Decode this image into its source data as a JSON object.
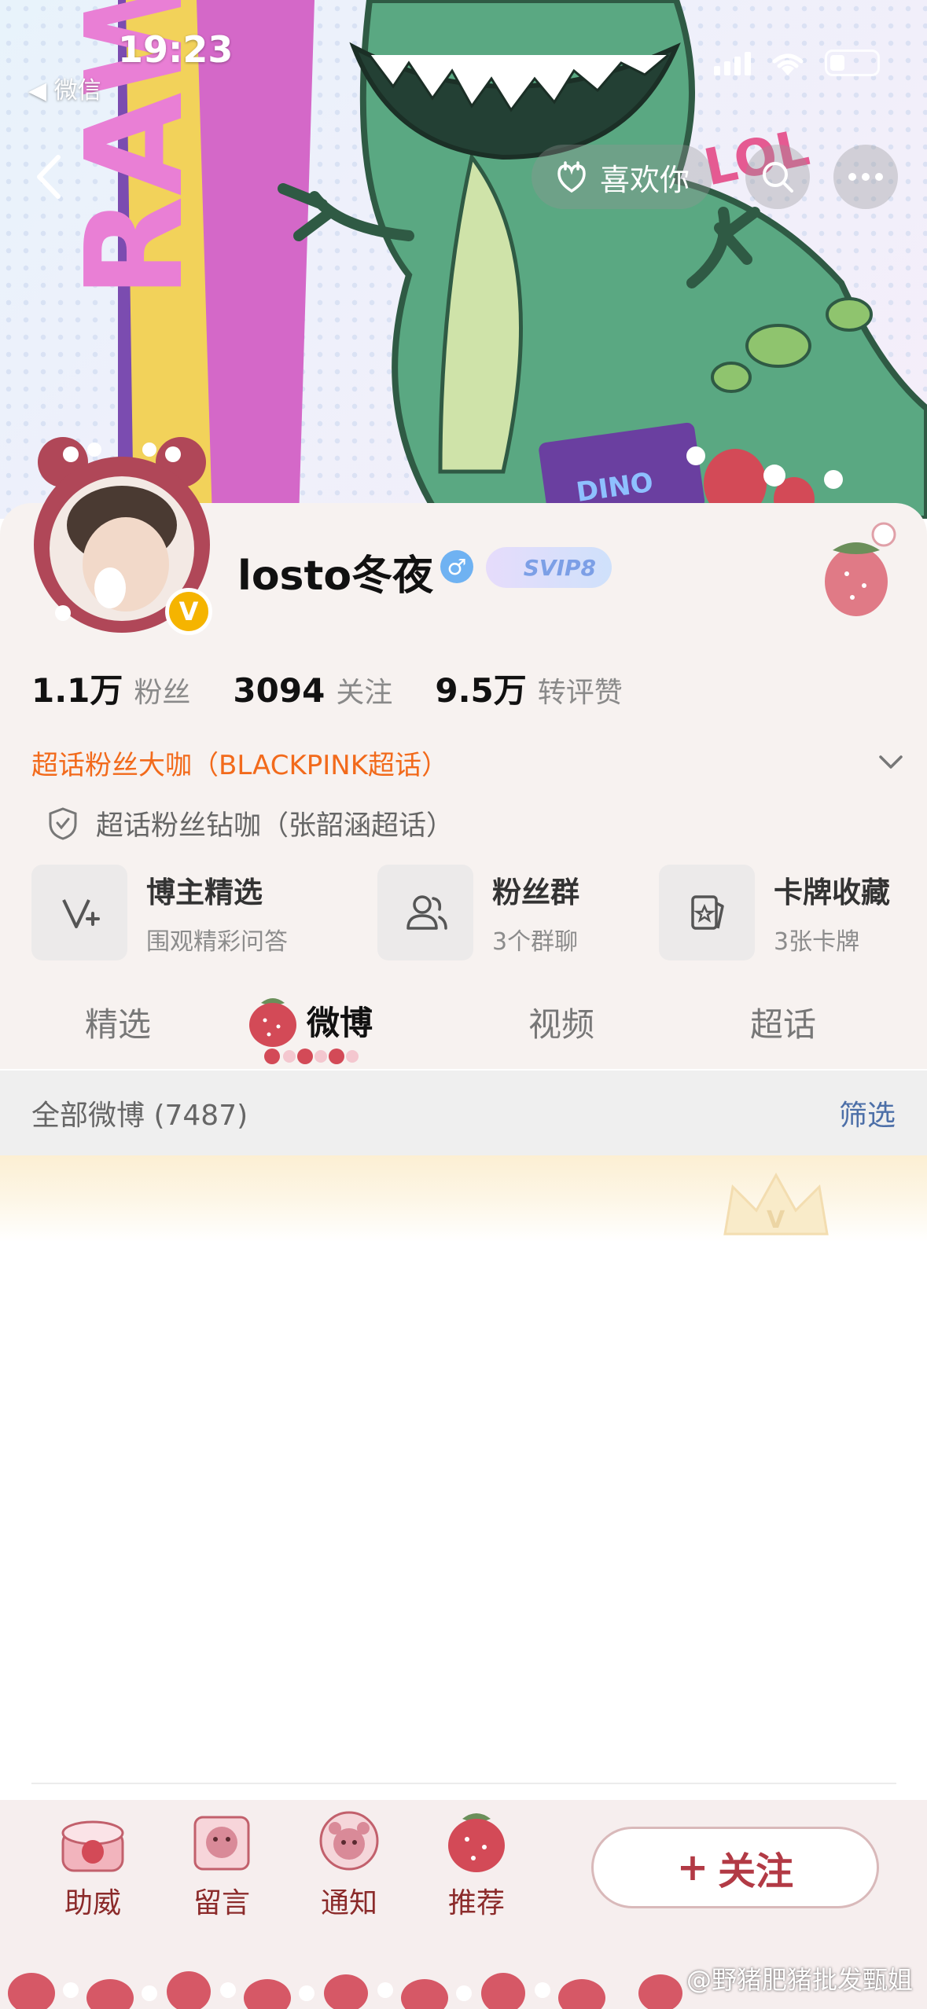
{
  "status_bar": {
    "time": "19:23",
    "back_app": "◀ 微信"
  },
  "header": {
    "like_label": "喜欢你"
  },
  "profile": {
    "name": "losto冬夜",
    "gender_symbol": "♂",
    "vip_badge": "SVIP8",
    "verified_symbol": "V"
  },
  "stats": [
    {
      "value": "1.1万",
      "label": "粉丝"
    },
    {
      "value": "3094",
      "label": "关注"
    },
    {
      "value": "9.5万",
      "label": "转评赞"
    }
  ],
  "super_topic": "超话粉丝大咖（BLACKPINK超话）",
  "diamond_topic": "超话粉丝钻咖（张韶涵超话）",
  "features": [
    {
      "title": "博主精选",
      "subtitle": "围观精彩问答"
    },
    {
      "title": "粉丝群",
      "subtitle": "3个群聊"
    },
    {
      "title": "卡牌收藏",
      "subtitle": "3张卡牌"
    }
  ],
  "tabs": [
    {
      "label": "精选",
      "active": false
    },
    {
      "label": "微博",
      "active": true
    },
    {
      "label": "视频",
      "active": false
    },
    {
      "label": "超话",
      "active": false
    }
  ],
  "filter": {
    "count_label": "全部微博 (7487)",
    "button": "筛选"
  },
  "bottom_bar": {
    "items": [
      "助威",
      "留言",
      "通知",
      "推荐"
    ],
    "follow_label": "关注",
    "follow_plus": "+"
  },
  "banner_text": {
    "dino_card": "DINO",
    "lol": "LOL"
  },
  "watermark": "@野猪肥猪批发甄姐",
  "colors": {
    "accent_orange": "#f26a1b",
    "filter_blue": "#4c6fa8",
    "follow_red": "#b23a45",
    "verified_gold": "#f5b400"
  }
}
